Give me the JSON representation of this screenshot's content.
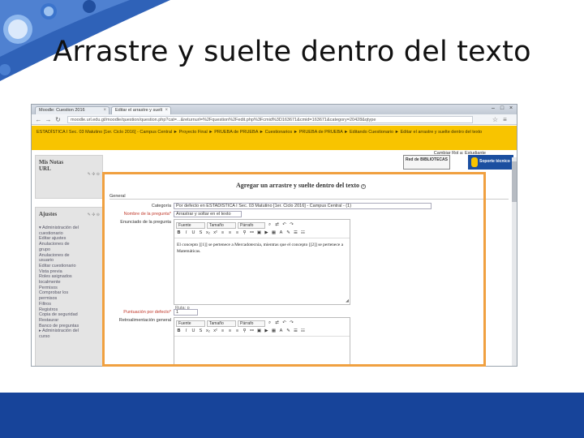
{
  "slide": {
    "title": "Arrastre y suelte dentro del texto",
    "colors": {
      "accent": "#17449a",
      "highlight": "#f0a040",
      "breadcrumb_bar": "#f8c400"
    }
  },
  "browser": {
    "tabs": [
      {
        "label": "Moodle: Cuestion 2016",
        "active": false
      },
      {
        "label": "Editar el arrastre y suelt",
        "active": true
      }
    ],
    "url": "moodle.url.edu.gt/moodle/question/question.php?cat=...&returnurl=%2Fquestion%2Fedit.php%3Fcmid%3D163671&cmid=163671&category=20428&qtype",
    "breadcrumbs": "ESTADÍSTICA I Sec. 03 Matutino [1er. Ciclo 2016] - Campus Central ► Proyecto Final ► PRUEBA de PRUEBA ► Cuestionarios ► PRUEBA de PRUEBA ► Editando Cuestionario ► Editar el arrastre y suelte dentro del texto",
    "user_role": "Cambiar Rol a: Estudiante"
  },
  "sidebar": {
    "notes_block": {
      "title_line1": "Mis Notas",
      "title_line2": "URL"
    },
    "settings_block": {
      "title": "Ajustes",
      "items": [
        "▾ Administración del",
        "   cuestionario",
        "   Editar ajustes",
        "   Anulaciones de",
        "   grupo",
        "   Anulaciones de",
        "   usuario",
        "   Editar cuestionario",
        "   Vista previa",
        "   Roles asignados",
        "   localmente",
        "   Permisos",
        "   Comprobar los",
        "   permisos",
        "   Filtros",
        "   Registros",
        "   Copia de seguridad",
        "   Restaurar",
        "   Banco de preguntas",
        "▸ Administración del",
        "   curso"
      ]
    }
  },
  "header_logos": {
    "library": "Red de BIBLIOTECAS",
    "support": "Soporte técnico"
  },
  "form": {
    "title": "Agregar un arrastre y suelte dentro del texto",
    "section_general": "General",
    "category_label": "Categoría",
    "category_value": "Por defecto en ESTADÍSTICA I Sec. 03 Matutino [1er. Ciclo 2016] - Campus Central - (1)",
    "name_label": "Nombre de la pregunta*",
    "name_value": "Arrastrar y soltar en el texto",
    "question_text_label": "Enunciado de la pregunta",
    "toolbar_font": "Fuente",
    "toolbar_size": "Tamaño",
    "toolbar_format": "Párrafo",
    "question_text": "El concepto [[1]] se pertenece a Mercadotecnia, mientras que el concepto [[2]] se pertenece a Matemáticas.",
    "path_label": "Ruta: p",
    "default_mark_label": "Puntuación por defecto*",
    "default_mark_value": "1",
    "general_feedback_label": "Retroalimentación general"
  }
}
